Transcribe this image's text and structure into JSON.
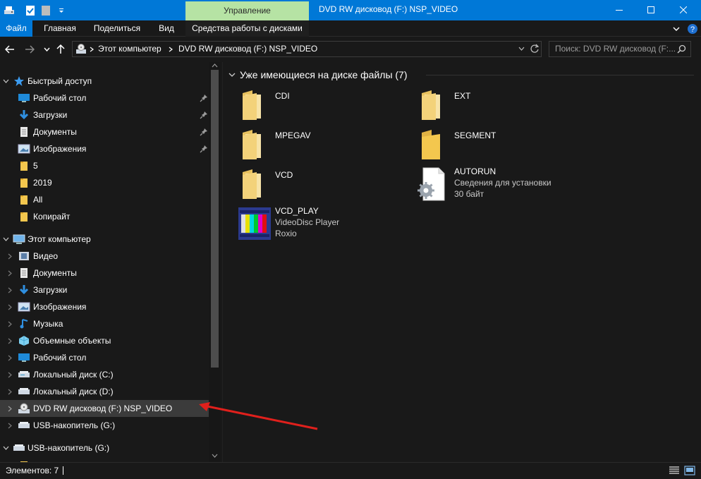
{
  "window": {
    "title": "DVD RW дисковод (F:) NSP_VIDEO",
    "manage_tab": "Управление",
    "accent": "#0078d7",
    "manage_color": "#b6e3a4"
  },
  "ribbon": {
    "tabs": [
      "Файл",
      "Главная",
      "Поделиться",
      "Вид",
      "Средства работы с дисками"
    ]
  },
  "address": {
    "segments": [
      "Этот компьютер",
      "DVD RW дисковод (F:) NSP_VIDEO"
    ],
    "search_placeholder": "Поиск: DVD RW дисковод (F:..."
  },
  "nav": {
    "quick_access": "Быстрый доступ",
    "quick_items": [
      {
        "label": "Рабочий стол",
        "icon": "desktop-icon",
        "pinned": true
      },
      {
        "label": "Загрузки",
        "icon": "download-icon",
        "pinned": true
      },
      {
        "label": "Документы",
        "icon": "documents-icon",
        "pinned": true
      },
      {
        "label": "Изображения",
        "icon": "pictures-icon",
        "pinned": true
      },
      {
        "label": "5",
        "icon": "folder-icon",
        "pinned": false
      },
      {
        "label": "2019",
        "icon": "folder-icon",
        "pinned": false
      },
      {
        "label": "All",
        "icon": "folder-icon",
        "pinned": false
      },
      {
        "label": "Копирайт",
        "icon": "folder-icon",
        "pinned": false
      }
    ],
    "this_pc": "Этот компьютер",
    "pc_items": [
      {
        "label": "Видео",
        "icon": "video-icon"
      },
      {
        "label": "Документы",
        "icon": "documents-icon"
      },
      {
        "label": "Загрузки",
        "icon": "download-icon"
      },
      {
        "label": "Изображения",
        "icon": "pictures-icon"
      },
      {
        "label": "Музыка",
        "icon": "music-icon"
      },
      {
        "label": "Объемные объекты",
        "icon": "3d-objects-icon"
      },
      {
        "label": "Рабочий стол",
        "icon": "desktop-icon"
      },
      {
        "label": "Локальный диск (C:)",
        "icon": "drive-icon"
      },
      {
        "label": "Локальный диск (D:)",
        "icon": "drive-icon"
      },
      {
        "label": "DVD RW дисковод (F:) NSP_VIDEO",
        "icon": "dvd-drive-icon",
        "selected": true
      },
      {
        "label": "USB-накопитель (G:)",
        "icon": "usb-drive-icon"
      }
    ],
    "usb_root": "USB-накопитель (G:)"
  },
  "content": {
    "group_title": "Уже имеющиеся на диске файлы (7)",
    "files": [
      {
        "name": "CDI",
        "type": "folder"
      },
      {
        "name": "EXT",
        "type": "folder"
      },
      {
        "name": "MPEGAV",
        "type": "folder"
      },
      {
        "name": "SEGMENT",
        "type": "folder"
      },
      {
        "name": "VCD",
        "type": "folder"
      },
      {
        "name": "AUTORUN",
        "type": "setup",
        "line1": "Сведения для установки",
        "line2": "30 байт"
      },
      {
        "name": "VCD_PLAY",
        "type": "app",
        "line1": "VideoDisc Player",
        "line2": "Roxio"
      }
    ]
  },
  "status": {
    "items_text": "Элементов: 7"
  }
}
